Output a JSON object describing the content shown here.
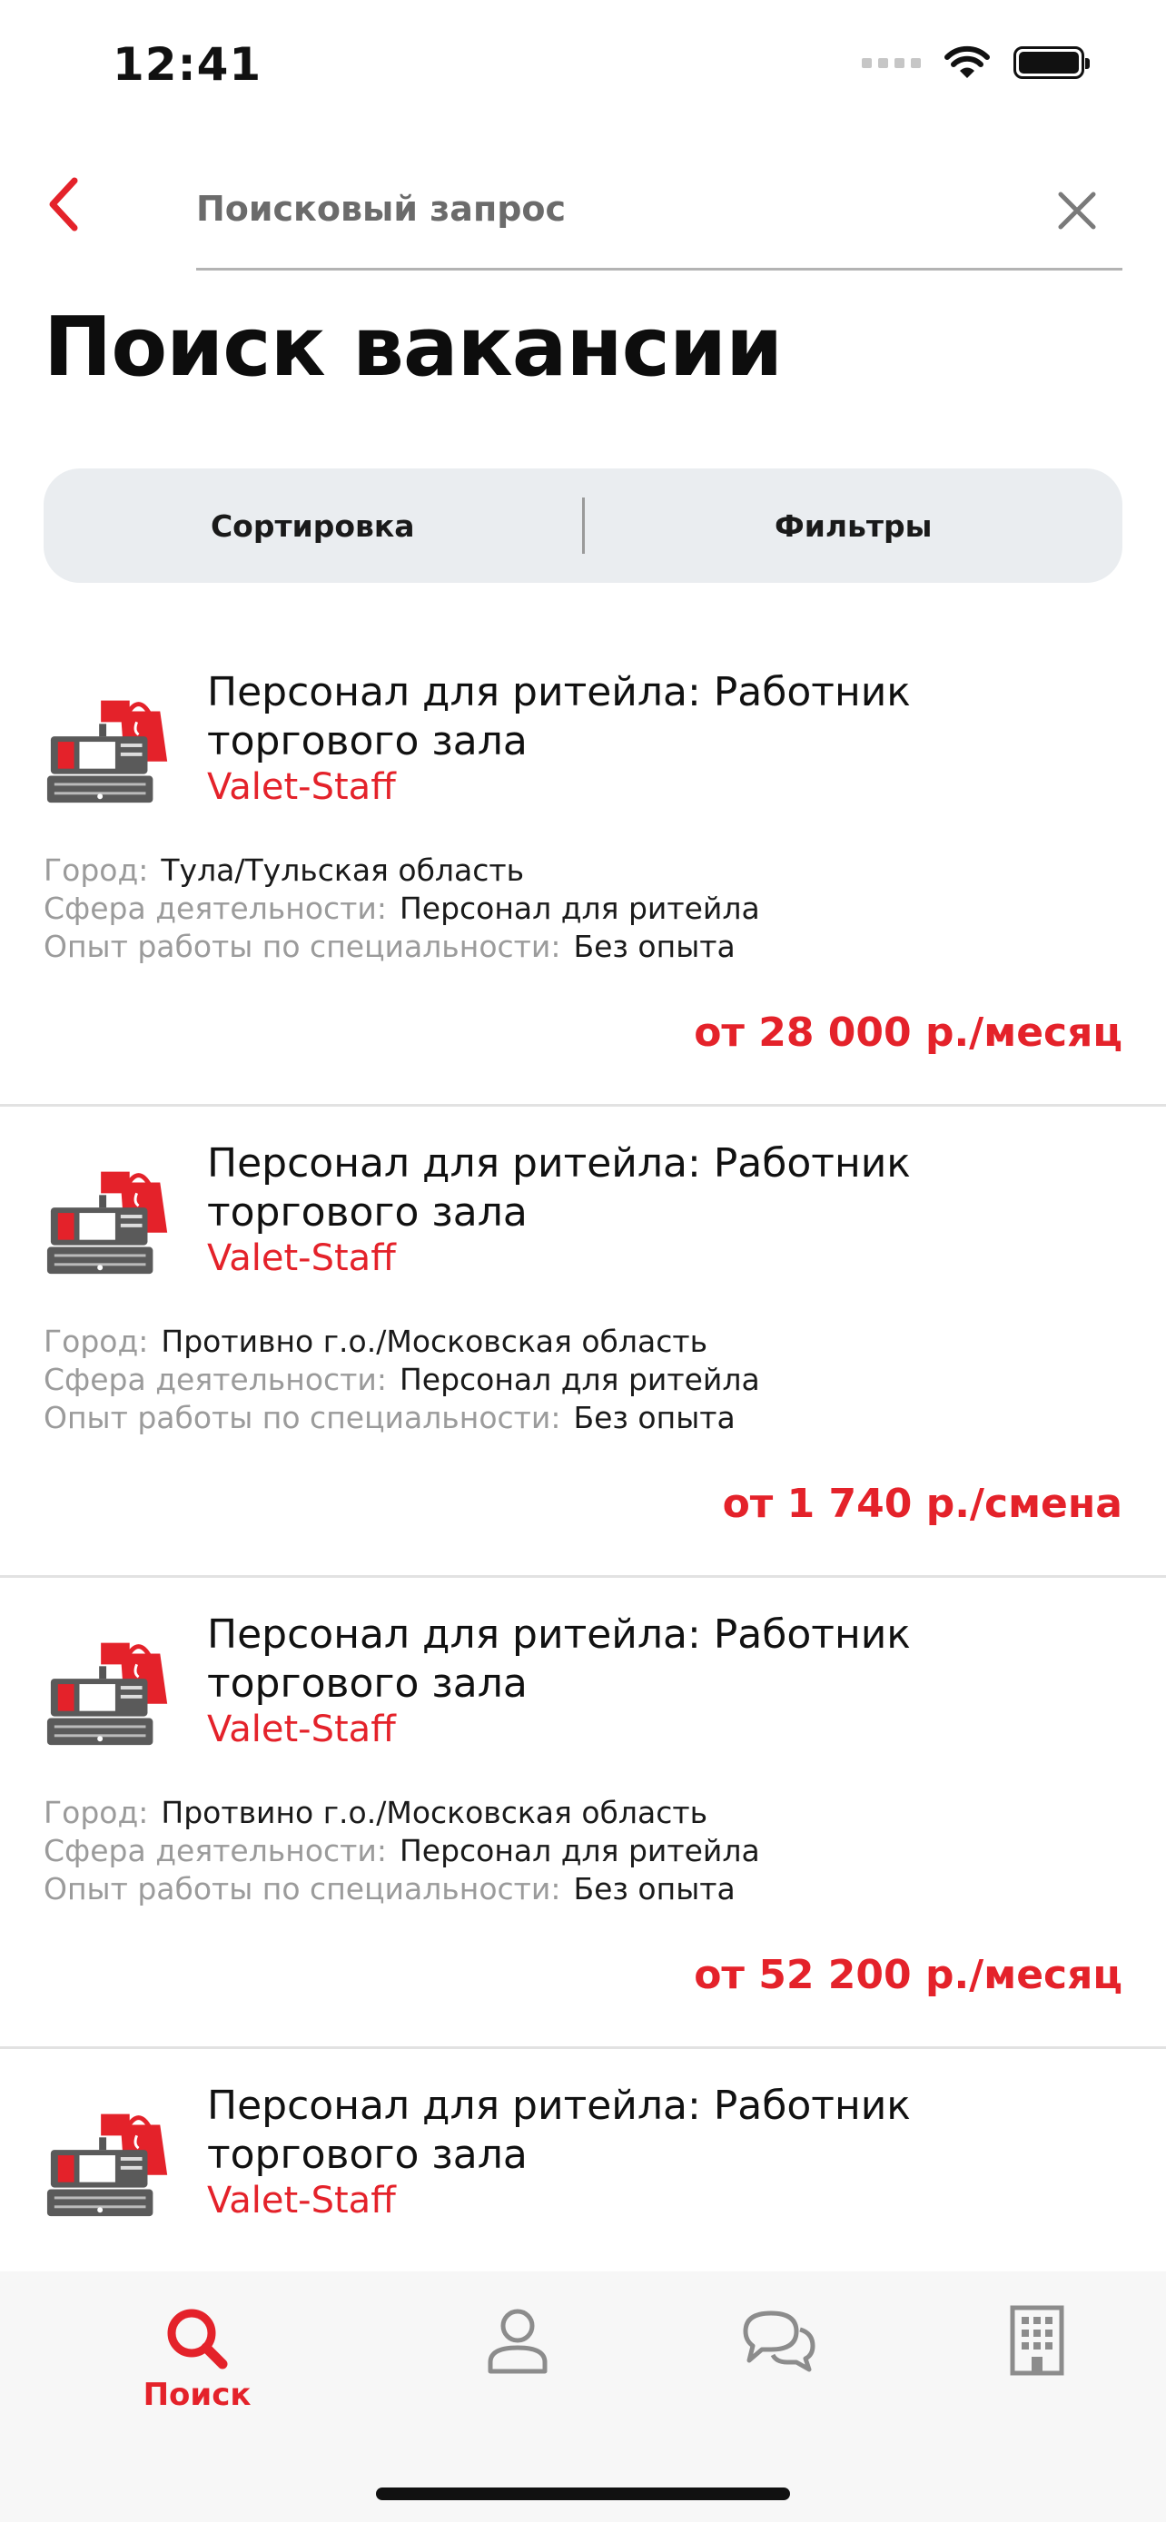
{
  "status_bar": {
    "time": "12:41"
  },
  "search": {
    "placeholder": "Поисковый запрос",
    "value": ""
  },
  "page": {
    "title": "Поиск вакансии"
  },
  "controls": {
    "sort_label": "Сортировка",
    "filter_label": "Фильтры"
  },
  "labels": {
    "city": "Город:",
    "sphere": "Сфера деятельности:",
    "experience": "Опыт работы по специальности:"
  },
  "jobs": [
    {
      "title": "Персонал для ритейла: Работник торгового зала",
      "company": "Valet-Staff",
      "city": "Тула/Тульская область",
      "sphere": "Персонал для ритейла",
      "experience": "Без опыта",
      "salary": "от 28 000 р./месяц"
    },
    {
      "title": "Персонал для ритейла: Работник торгового зала",
      "company": "Valet-Staff",
      "city": "Противно г.о./Московская область",
      "sphere": "Персонал для ритейла",
      "experience": "Без опыта",
      "salary": "от 1 740 р./смена"
    },
    {
      "title": "Персонал для ритейла: Работник торгового зала",
      "company": "Valet-Staff",
      "city": "Протвино г.о./Московская область",
      "sphere": "Персонал для ритейла",
      "experience": "Без опыта",
      "salary": "от 52 200 р./месяц"
    },
    {
      "title": "Персонал для ритейла: Работник торгового зала",
      "company": "Valet-Staff",
      "city": "",
      "sphere": "",
      "experience": "",
      "salary": ""
    }
  ],
  "tab_bar": {
    "tabs": [
      {
        "label": "Поиск",
        "icon": "search-icon",
        "active": true
      },
      {
        "label": "",
        "icon": "profile-icon",
        "active": false
      },
      {
        "label": "",
        "icon": "chat-icon",
        "active": false
      },
      {
        "label": "",
        "icon": "building-icon",
        "active": false
      }
    ]
  },
  "colors": {
    "accent": "#e4222a",
    "segment_bg": "#eaedf0",
    "icon_gray": "#8c8c8c"
  }
}
